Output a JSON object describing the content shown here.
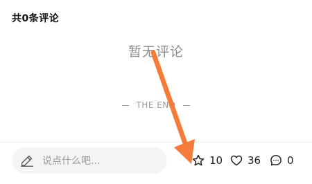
{
  "header": {
    "comment_count_label": "共0条评论"
  },
  "empty_state": {
    "message": "暂无评论"
  },
  "footer_marker": {
    "label": "THE END"
  },
  "bottom_bar": {
    "input_placeholder": "说点什么吧...",
    "favorite": {
      "icon": "star-icon",
      "count": "10"
    },
    "like": {
      "icon": "heart-icon",
      "count": "36"
    },
    "comment": {
      "icon": "comment-bubble-icon",
      "count": "0"
    }
  },
  "annotation": {
    "arrow_color": "#f47b3a"
  }
}
